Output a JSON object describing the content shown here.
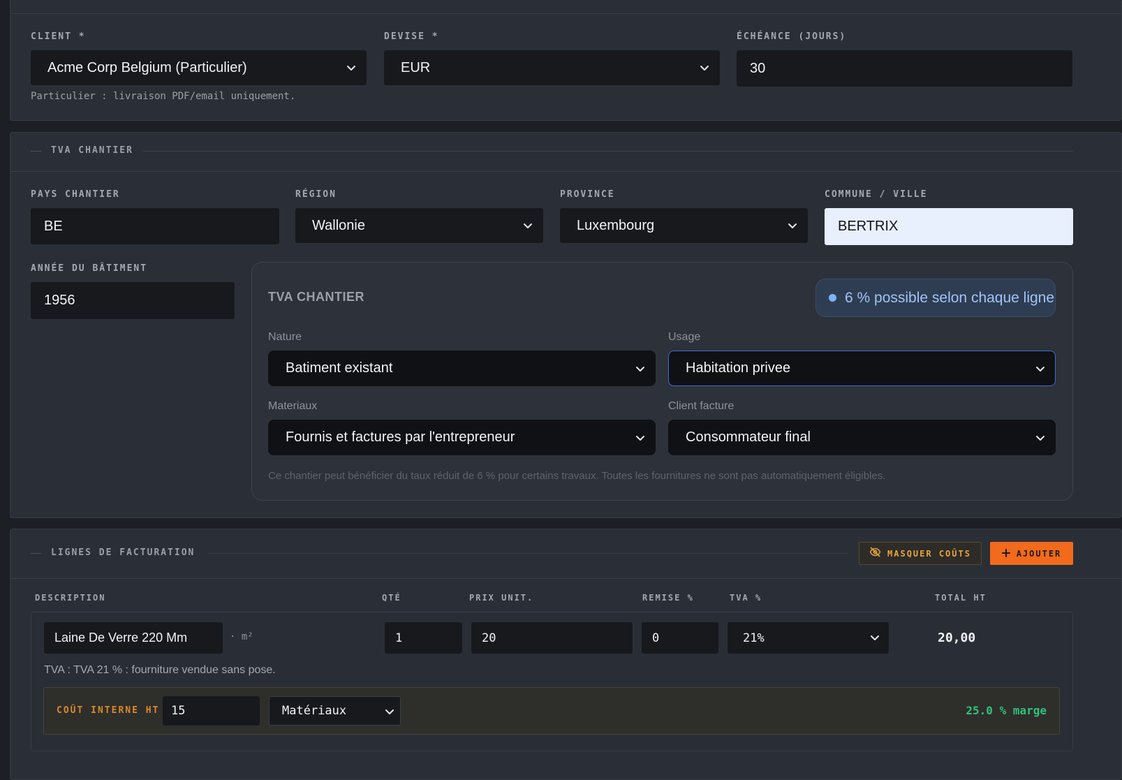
{
  "client_section": {
    "client_label": "CLIENT *",
    "client_value": "Acme Corp Belgium (Particulier)",
    "devise_label": "DEVISE *",
    "devise_value": "EUR",
    "echeance_label": "ÉCHÉANCE (JOURS)",
    "echeance_value": "30",
    "hint": "Particulier : livraison PDF/email uniquement."
  },
  "tva_chantier": {
    "section_title": "TVA CHANTIER",
    "pays_label": "PAYS CHANTIER",
    "pays_value": "BE",
    "region_label": "RÉGION",
    "region_value": "Wallonie",
    "province_label": "PROVINCE",
    "province_value": "Luxembourg",
    "commune_label": "COMMUNE / VILLE",
    "commune_value": "BERTRIX",
    "annee_label": "ANNÉE DU BÂTIMENT",
    "annee_value": "1956",
    "card": {
      "title": "TVA CHANTIER",
      "badge": "6 % possible selon chaque ligne",
      "nature_label": "Nature",
      "nature_value": "Batiment existant",
      "usage_label": "Usage",
      "usage_value": "Habitation privee",
      "materiaux_label": "Materiaux",
      "materiaux_value": "Fournis et factures par l'entrepreneur",
      "client_facture_label": "Client facture",
      "client_facture_value": "Consommateur final",
      "note": "Ce chantier peut bénéficier du taux réduit de 6 % pour certains travaux. Toutes les fournitures ne sont pas automatiquement éligibles."
    }
  },
  "lignes": {
    "section_title": "LIGNES DE FACTURATION",
    "hide_costs_button": "MASQUER COÛTS",
    "add_button": "AJOUTER",
    "columns": [
      "DESCRIPTION",
      "QTÉ",
      "PRIX UNIT.",
      "REMISE %",
      "TVA %",
      "TOTAL HT"
    ],
    "rows": [
      {
        "description": "Laine De Verre 220 Mm",
        "unit": "· m²",
        "qty": "1",
        "price": "20",
        "discount": "0",
        "tva": "21%",
        "total": "20,00",
        "tva_note": "TVA : TVA 21 % : fourniture vendue sans pose.",
        "cost_label": "COÛT INTERNE HT",
        "cost_value": "15",
        "cost_category": "Matériaux",
        "margin": "25.0 % marge"
      }
    ]
  },
  "colors": {
    "accent_orange": "#f26a1b",
    "margin_green": "#2fc27a",
    "badge_blue": "#7fb2f5",
    "cost_label_orange": "#d98a2b"
  }
}
